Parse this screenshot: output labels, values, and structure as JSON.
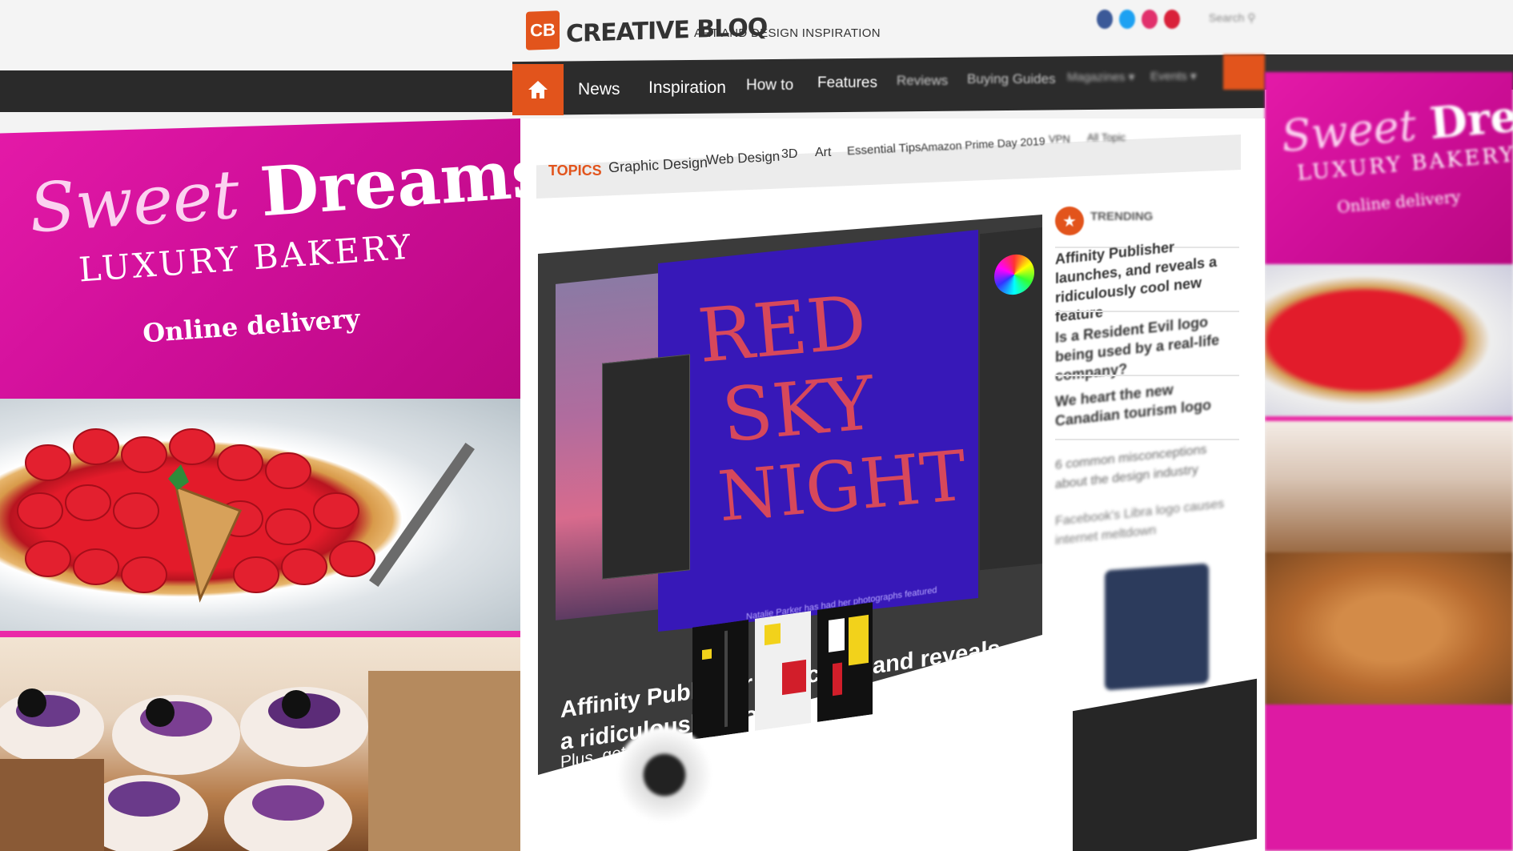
{
  "site": {
    "logo_mark": "CB",
    "logo_text": "CREATIVE BLOQ",
    "tagline": "ART AND DESIGN INSPIRATION",
    "search_label": "Search",
    "social_colors": [
      "#3b5998",
      "#1da1f2",
      "#e1306c",
      "#d9213a"
    ]
  },
  "nav": {
    "items": [
      "News",
      "Inspiration",
      "How to",
      "Features",
      "Reviews",
      "Buying Guides",
      "Magazines ▾",
      "Events ▾"
    ],
    "accent": "#e2541c"
  },
  "ad": {
    "sweet": "Sweet",
    "dreams": "Dreams",
    "subtitle": "LUXURY BAKERY",
    "delivery": "Online delivery"
  },
  "topics": {
    "label": "TOPICS",
    "items": [
      "Graphic Design",
      "Web Design",
      "3D",
      "Art",
      "Essential Tips",
      "Amazon Prime Day 2019",
      "VPN",
      "All Topic"
    ]
  },
  "hero": {
    "art_words": [
      "RED",
      "SKY",
      "NIGHT"
    ],
    "caption": "Natalie Parker has had her photographs featured",
    "title": "Affinity Publisher launches, and reveals a ridiculously cool new feature",
    "subtitle": "Plus, get 20% off."
  },
  "trending": {
    "label": "TRENDING",
    "items": [
      "Affinity Publisher launches, and reveals a ridiculously cool new feature",
      "Is a Resident Evil logo being used by a real-life company?",
      "We heart the new Canadian tourism logo",
      "6 common misconceptions about the design industry",
      "Facebook's Libra logo causes internet meltdown"
    ]
  }
}
